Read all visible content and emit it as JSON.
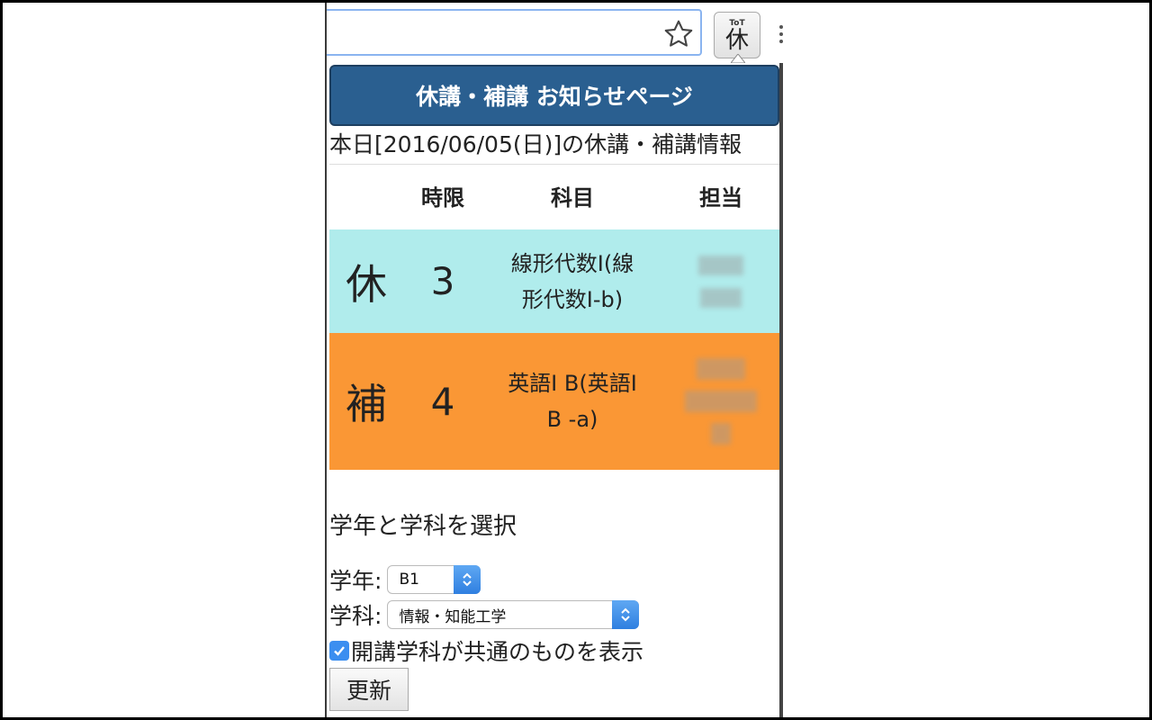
{
  "popup": {
    "header_title": "休講・補講 お知らせページ",
    "today_line": "本日[2016/06/05(日)]の休講・補講情報"
  },
  "extension_button": {
    "top_text": "ToT",
    "kanji": "休"
  },
  "table": {
    "headers": [
      "時限",
      "科目",
      "担当"
    ],
    "rows": [
      {
        "type": "休",
        "period": "3",
        "subject_line1": "線形代数I(線",
        "subject_line2": "形代数I-b)",
        "row_color": "#b0ecec"
      },
      {
        "type": "補",
        "period": "4",
        "subject_line1": "英語I B(英語I",
        "subject_line2": "B -a)",
        "row_color": "#fa9735"
      }
    ]
  },
  "form": {
    "heading": "学年と学科を選択",
    "year_label": "学年:",
    "year_value": "B1",
    "dept_label": "学科:",
    "dept_value": "情報・知能工学",
    "checkbox_label": "開講学科が共通のものを表示",
    "checkbox_checked": true,
    "update_button": "更新"
  },
  "colors": {
    "header_bg": "#2a5f90",
    "accent_blue": "#3b8ef0"
  }
}
